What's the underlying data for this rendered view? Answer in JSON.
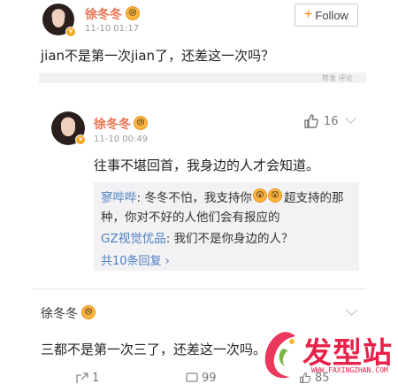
{
  "post": {
    "username": "徐冬冬",
    "timestamp": "11-10 01:17",
    "follow_label": "Follow",
    "content": "jian不是第一次jian了，还差这一次吗？",
    "footer_hint": "转发 评论"
  },
  "comment": {
    "username": "徐冬冬",
    "timestamp": "11-10 00:49",
    "like_count": "16",
    "content": "往事不堪回首，我身边的人才会知道。",
    "replies": [
      {
        "user": "寥哔哔",
        "text_line1": ": 冬冬不怕，我支持你",
        "text_after_emoji": "超支持的那",
        "text_line2": "种，你对不好的人他们会有报应的"
      },
      {
        "user": "GZ视觉优品",
        "text": ": 我们不是你身边的人？"
      }
    ],
    "more_replies": "共10条回复 ›"
  },
  "bottom_post": {
    "username": "徐冬冬",
    "content": "三都不是第一次三了，还差这一次吗。",
    "share_count": "1",
    "comment_count": "99",
    "like_count": "85"
  },
  "watermark": {
    "brand": "发型站",
    "url": "WWW.FAXINGZHAN.COM"
  },
  "colors": {
    "name_orange": "#eb7350",
    "link_blue": "#4f7fbf",
    "brand_red": "#e8214a"
  }
}
